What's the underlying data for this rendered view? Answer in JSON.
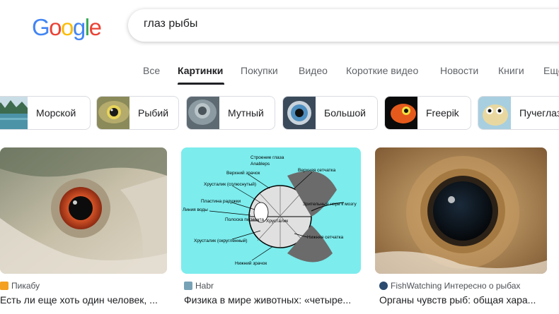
{
  "logo": {
    "letters": [
      "G",
      "o",
      "o",
      "g",
      "l",
      "e"
    ],
    "colors": [
      "#4285F4",
      "#EA4335",
      "#FBBC05",
      "#4285F4",
      "#34A853",
      "#EA4335"
    ]
  },
  "search": {
    "query": "глаз рыбы"
  },
  "tabs": [
    {
      "label": "Все"
    },
    {
      "label": "Картинки"
    },
    {
      "label": "Покупки"
    },
    {
      "label": "Видео"
    },
    {
      "label": "Короткие видео"
    },
    {
      "label": "Новости"
    },
    {
      "label": "Книги"
    },
    {
      "label": "Еще"
    }
  ],
  "active_tab": "Картинки",
  "chips": [
    {
      "label": "Морской",
      "icon": "lake-thumbnail"
    },
    {
      "label": "Рыбий",
      "icon": "fish-eye-thumbnail"
    },
    {
      "label": "Мутный",
      "icon": "cloudy-eye-thumbnail"
    },
    {
      "label": "Большой",
      "icon": "big-eye-thumbnail"
    },
    {
      "label": "Freepik",
      "icon": "orange-fish-thumbnail"
    },
    {
      "label": "Пучеглазый",
      "icon": "puffer-fish-thumbnail"
    }
  ],
  "results": [
    {
      "source": "Пикабу",
      "title": "Есть ли еще хоть один человек, ...",
      "icon_color": "#F4A020"
    },
    {
      "source": "Habr",
      "title": "Физика в мире животных: «четыре...",
      "icon_color": "#77A2B6"
    },
    {
      "source": "FishWatching Интересно о рыбах",
      "title": "Органы чувств рыб: общая хара...",
      "icon_color": "#2B4B6F"
    }
  ],
  "diagram": {
    "title": "Строение глаза",
    "subtitle": "Anableps",
    "labels": {
      "upper_pupil": "Верхний зрачок",
      "upper_retina": "Верхняя сетчатка",
      "lens_flat": "Хрусталик (сплюснутый)",
      "optic_nerve": "Зрительный нерв к мозгу",
      "iris_plate": "Пластина радужки",
      "water_line": "Линия воды",
      "pigment_stripe": "Полоска пигмента",
      "lens": "Хрусталик",
      "lower_retina": "Нижняя сетчатка",
      "lens_round": "Хрусталик (округленный)",
      "lower_pupil": "Нижний зрачок"
    }
  }
}
